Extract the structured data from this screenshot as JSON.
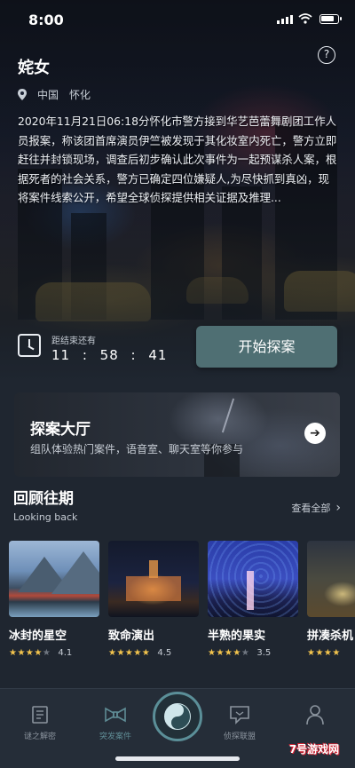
{
  "status_bar": {
    "time": "8:00"
  },
  "case": {
    "title": "姹女",
    "country": "中国",
    "city": "怀化",
    "description": "2020年11月21日06:18分怀化市警方接到华艺芭蕾舞剧团工作人员报案，称该团首席演员伊竺被发现于其化妆室内死亡，警方立即赶往并封锁现场，调查后初步确认此次事件为一起预谋杀人案，根据死者的社会关系，警方已确定四位嫌疑人,为尽快抓到真凶，现将案件线索公开，希望全球侦探提供相关证据及推理..."
  },
  "countdown": {
    "label": "距结束还有",
    "time": "11 : 58 : 41"
  },
  "start_button": {
    "label": "开始探案"
  },
  "hall": {
    "title": "探案大厅",
    "subtitle": "组队体验热门案件，语音室、聊天室等你参与"
  },
  "looking_back": {
    "title": "回顾往期",
    "subtitle": "Looking back",
    "view_all": "查看全部",
    "cards": [
      {
        "name": "冰封的星空",
        "stars": 4,
        "score": "4.1"
      },
      {
        "name": "致命演出",
        "stars": 5,
        "score": "4.5"
      },
      {
        "name": "半熟的果实",
        "stars": 4,
        "score": "3.5"
      },
      {
        "name": "拼凑杀机",
        "stars": 4,
        "score": ""
      }
    ]
  },
  "tabbar": {
    "tabs": [
      {
        "label": "谜之解密",
        "icon": "book-icon"
      },
      {
        "label": "突发案件",
        "icon": "bowtie-icon"
      },
      {
        "label": "",
        "icon": "yin-yang-icon"
      },
      {
        "label": "侦探联盟",
        "icon": "chat-icon"
      },
      {
        "label": "",
        "icon": "person-icon"
      }
    ]
  },
  "watermark": "7号游戏网",
  "colors": {
    "accent": "#5b8f98",
    "button": "#4f6f73",
    "star": "#f3c44d",
    "background": "#1f2630"
  }
}
